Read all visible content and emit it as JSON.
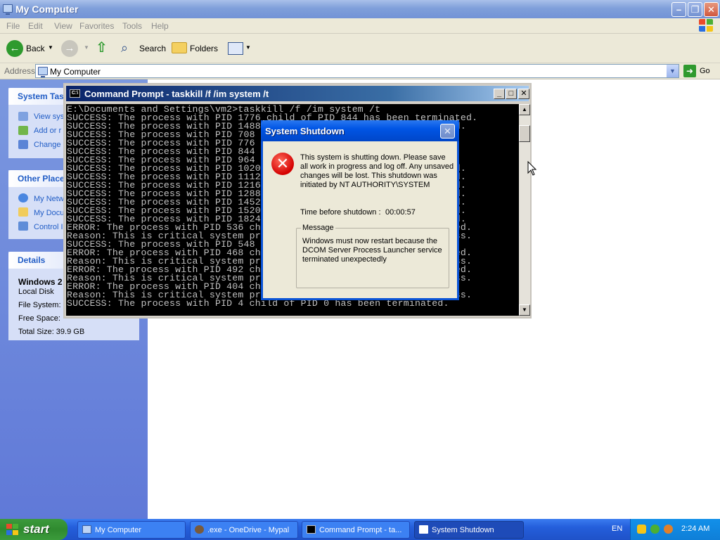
{
  "explorer": {
    "title": "My Computer",
    "menu": [
      "File",
      "Edit",
      "View",
      "Favorites",
      "Tools",
      "Help"
    ],
    "toolbar": {
      "back": "Back",
      "search": "Search",
      "folders": "Folders"
    },
    "address": {
      "label": "Address",
      "value": "My Computer",
      "go": "Go"
    },
    "system_tasks": {
      "header": "System Tas",
      "items": [
        "View sys",
        "Add or r",
        "Change"
      ]
    },
    "other_places": {
      "header": "Other Place",
      "items": [
        "My Netw",
        "My Docu",
        "Control I"
      ]
    },
    "details": {
      "header": "Details",
      "name": "Windows 2",
      "type": "Local Disk",
      "file_system": "File System:",
      "free_space": "Free Space:",
      "total_size": "Total Size: 39.9 GB"
    }
  },
  "cmd": {
    "title": "Command Prompt - taskkill /f /im system /t",
    "lines": [
      "E:\\Documents and Settings\\vm2>taskkill /f /im system /t",
      "SUCCESS: The process with PID 1776 child of PID 844 has been terminated.",
      "SUCCESS: The process with PID 1488                                  d.",
      "SUCCESS: The process with PID 708                                   .",
      "SUCCESS: The process with PID 776                                   .",
      "SUCCESS: The process with PID 844                                   .",
      "SUCCESS: The process with PID 964                                   .",
      "SUCCESS: The process with PID 1020                                  d.",
      "SUCCESS: The process with PID 1112                                  d.",
      "SUCCESS: The process with PID 1216                                  d.",
      "SUCCESS: The process with PID 1288                                  d.",
      "SUCCESS: The process with PID 1452                                  d.",
      "SUCCESS: The process with PID 1520                                  d.",
      "SUCCESS: The process with PID 1824                                  d.",
      "ERROR: The process with PID 536 chi                                 ed.",
      "Reason: This is critical system pro                                 ss.",
      "SUCCESS: The process with PID 548 c                                 .",
      "ERROR: The process with PID 468 chi                                 ed.",
      "Reason: This is critical system pro                                 ss.",
      "ERROR: The process with PID 492 chi                                 ed.",
      "Reason: This is critical system pro                                 ss.",
      "ERROR: The process with PID 404 chi                                 .",
      "Reason: This is critical system pro                                 ss.",
      "SUCCESS: The process with PID 4 child of PID 0 has been terminated."
    ]
  },
  "shutdown": {
    "title": "System Shutdown",
    "message": "This system is shutting down. Please save all work in progress and log off. Any unsaved changes will be lost. This shutdown was initiated by NT AUTHORITY\\SYSTEM",
    "time_label": "Time before shutdown :",
    "time_value": "00:00:57",
    "group_label": "Message",
    "reason": "Windows must now restart because the DCOM Server Process Launcher service terminated unexpectedly"
  },
  "taskbar": {
    "start": "start",
    "tasks": [
      "My Computer",
      ".exe - OneDrive - Mypal",
      "Command Prompt - ta...",
      "System Shutdown"
    ],
    "lang": "EN",
    "clock": "2:24 AM"
  },
  "colors": {
    "xp_blue": "#0055e5",
    "start_green": "#2f8a2f",
    "error_red": "#d40000"
  }
}
